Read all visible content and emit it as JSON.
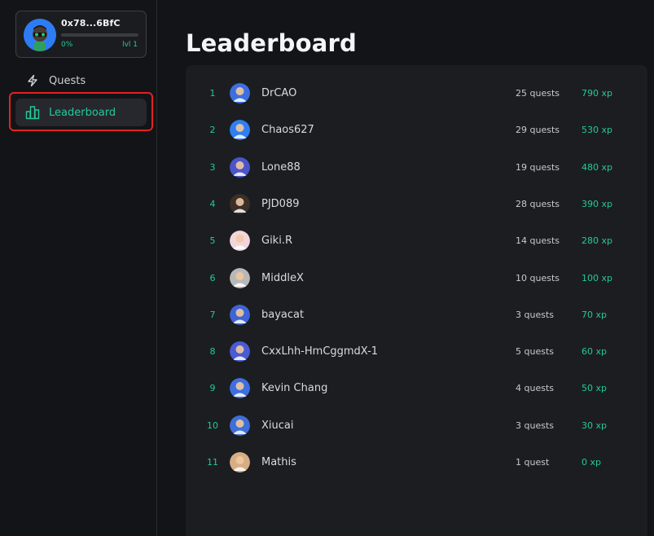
{
  "profile": {
    "address": "0x78...6BfC",
    "progress_label": "0%",
    "progress_fraction": 0.0,
    "level_label": "lvl 1"
  },
  "nav": {
    "items": [
      {
        "label": "Quests",
        "icon": "lightning-icon"
      },
      {
        "label": "Leaderboard",
        "icon": "bar-chart-icon",
        "active": true
      }
    ]
  },
  "page": {
    "title": "Leaderboard"
  },
  "colors": {
    "accent": "#23c99c",
    "highlight": "#e0231f",
    "panel": "#1c1d21"
  },
  "leaderboard": [
    {
      "rank": "1",
      "name": "DrCAO",
      "quests": "25 quests",
      "xp": "790 xp"
    },
    {
      "rank": "2",
      "name": "Chaos627",
      "quests": "29 quests",
      "xp": "530 xp"
    },
    {
      "rank": "3",
      "name": "Lone88",
      "quests": "19 quests",
      "xp": "480 xp"
    },
    {
      "rank": "4",
      "name": "PJD089",
      "quests": "28 quests",
      "xp": "390 xp"
    },
    {
      "rank": "5",
      "name": "Giki.R",
      "quests": "14 quests",
      "xp": "280 xp"
    },
    {
      "rank": "6",
      "name": "MiddleX",
      "quests": "10 quests",
      "xp": "100 xp"
    },
    {
      "rank": "7",
      "name": "bayacat",
      "quests": "3 quests",
      "xp": "70 xp"
    },
    {
      "rank": "8",
      "name": "CxxLhh-HmCggmdX-1",
      "quests": "5 quests",
      "xp": "60 xp"
    },
    {
      "rank": "9",
      "name": "Kevin Chang",
      "quests": "4 quests",
      "xp": "50 xp"
    },
    {
      "rank": "10",
      "name": "Xiucai",
      "quests": "3 quests",
      "xp": "30 xp"
    },
    {
      "rank": "11",
      "name": "Mathis",
      "quests": "1 quest",
      "xp": "0 xp"
    }
  ]
}
